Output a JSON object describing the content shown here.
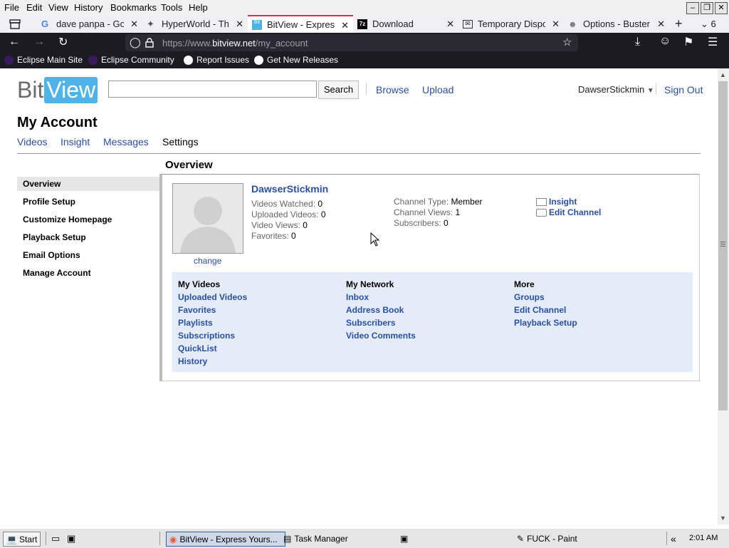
{
  "menubar": {
    "items": [
      "File",
      "Edit",
      "View",
      "History",
      "Bookmarks",
      "Tools",
      "Help"
    ]
  },
  "tabs": [
    {
      "title": "dave panpa - Goo",
      "icon": "google-icon"
    },
    {
      "title": "HyperWorld - The",
      "icon": "hyperworld-icon"
    },
    {
      "title": "BitView - Express",
      "icon": "bitview-icon",
      "active": true
    },
    {
      "title": "Download",
      "icon": "7zip-icon"
    },
    {
      "title": "Temporary Dispo",
      "icon": "mail-icon"
    },
    {
      "title": "Options - Buster:",
      "icon": "buster-icon"
    }
  ],
  "tab_overflow_count": "6",
  "url": {
    "prefix": "https://www.",
    "domain": "bitview.net",
    "path": "/my_account"
  },
  "bookmarks": [
    "Eclipse Main Site",
    "Eclipse Community",
    "Report Issues",
    "Get New Releases"
  ],
  "site": {
    "logo_bit": "Bit",
    "logo_view": "View",
    "search_button": "Search",
    "search_value": "",
    "nav_browse": "Browse",
    "nav_upload": "Upload",
    "username": "DawserStickmin",
    "sign_out": "Sign Out"
  },
  "account": {
    "heading": "My Account",
    "tabs": [
      "Videos",
      "Insight",
      "Messages",
      "Settings"
    ],
    "active_tab": "Settings",
    "section_title": "Overview"
  },
  "sidebar": {
    "items": [
      "Overview",
      "Profile Setup",
      "Customize Homepage",
      "Playback Setup",
      "Email Options",
      "Manage Account"
    ],
    "active": "Overview"
  },
  "profile": {
    "name": "DawserStickmin",
    "change_label": "change",
    "stats_left": [
      {
        "label": "Videos Watched:",
        "value": "0"
      },
      {
        "label": "Uploaded Videos:",
        "value": "0"
      },
      {
        "label": "Video Views:",
        "value": "0"
      },
      {
        "label": "Favorites:",
        "value": "0"
      }
    ],
    "stats_right": [
      {
        "label": "Channel Type:",
        "value": "Member"
      },
      {
        "label": "Channel Views:",
        "value": "1"
      },
      {
        "label": "Subscribers:",
        "value": "0"
      }
    ],
    "actions": [
      "Insight",
      "Edit Channel"
    ]
  },
  "links": {
    "my_videos": {
      "title": "My Videos",
      "items": [
        "Uploaded Videos",
        "Favorites",
        "Playlists",
        "Subscriptions",
        "QuickList",
        "History"
      ]
    },
    "my_network": {
      "title": "My Network",
      "items": [
        "Inbox",
        "Address Book",
        "Subscribers",
        "Video Comments"
      ]
    },
    "more": {
      "title": "More",
      "items": [
        "Groups",
        "Edit Channel",
        "Playback Setup"
      ]
    }
  },
  "taskbar": {
    "start": "Start",
    "tasks": [
      "BitView - Express Yours...",
      "Task Manager",
      "FUCK - Paint"
    ],
    "clock": "2:01 AM",
    "chevron": "«"
  },
  "colors": {
    "link": "#2b4fa3",
    "browser_dark": "#1c1b22",
    "tab_accent": "#e22850",
    "panel_bg": "#e3ecf8",
    "logo_blue": "#4fb3e8"
  }
}
